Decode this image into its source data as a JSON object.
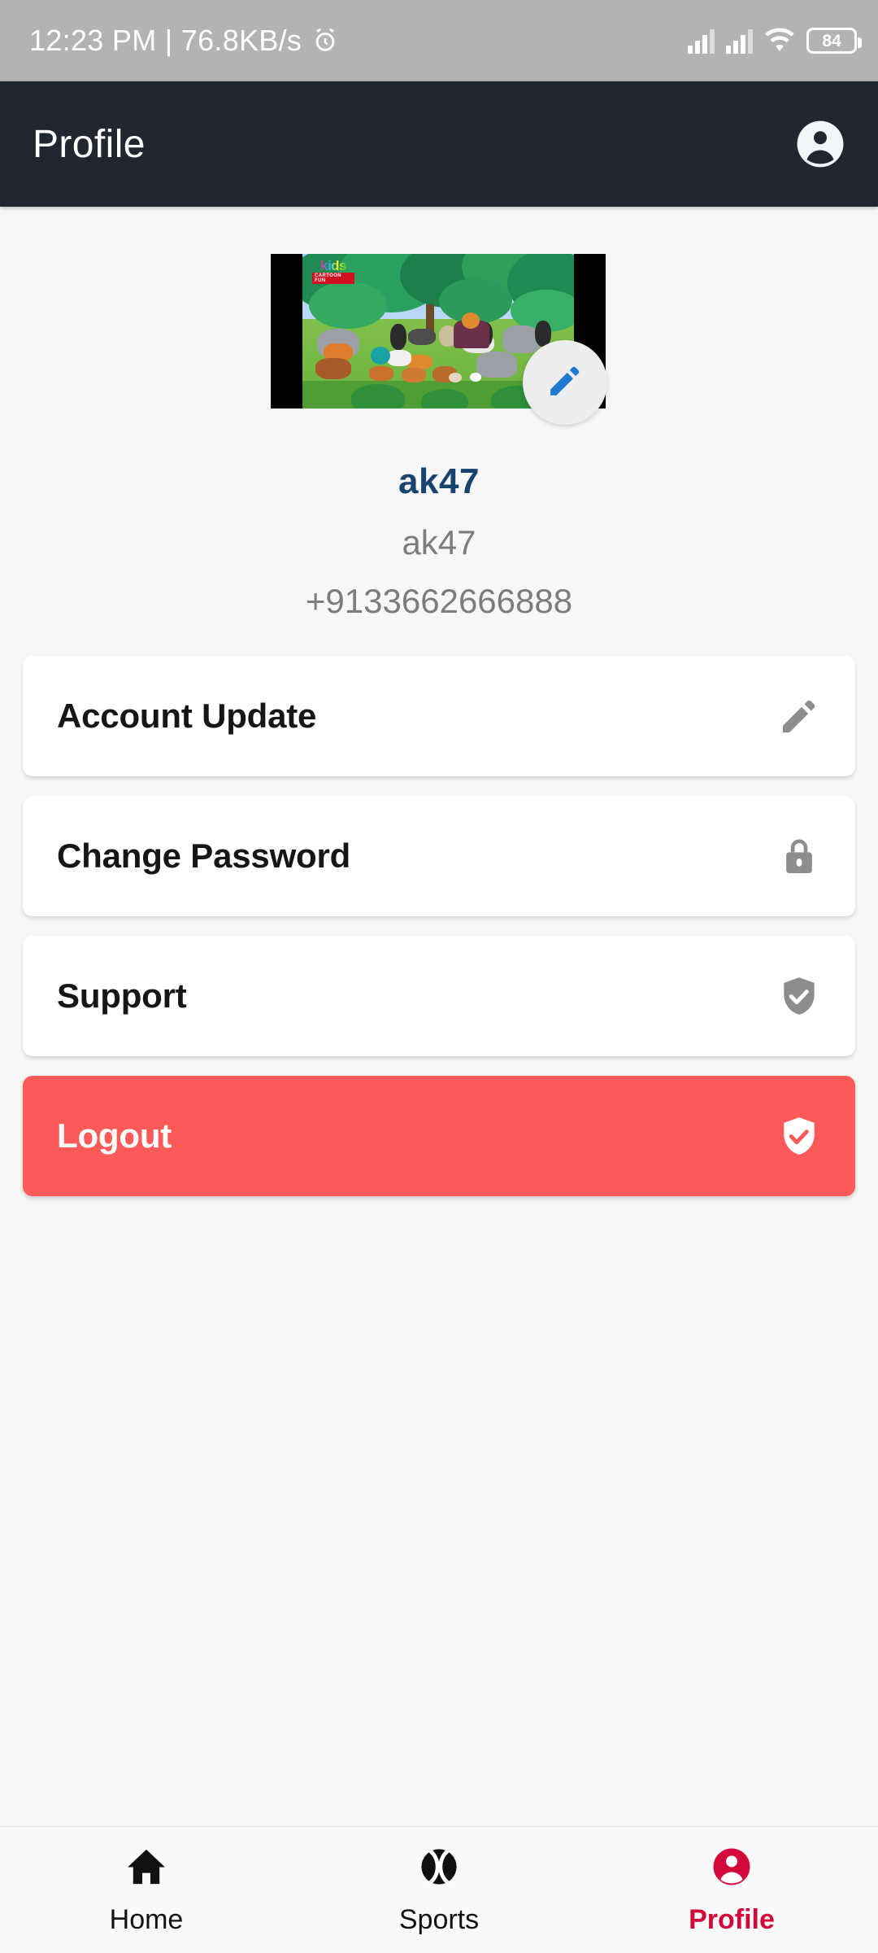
{
  "status_bar": {
    "text": "12:23 PM | 76.8KB/s",
    "alarm_icon": "alarm-clock-icon",
    "signal_icon": "cellular-signal-icon",
    "signal_icon_2": "cellular-signal-icon-2",
    "wifi_icon": "wifi-icon",
    "battery_level": "84"
  },
  "appbar": {
    "title": "Profile",
    "account_icon": "account-circle-icon"
  },
  "profile": {
    "image_alt": "kids-cartoon-jungle-animals-thumbnail",
    "image_watermark_primary": "kids",
    "image_watermark_secondary": "CARTOON FUN",
    "edit_icon": "pencil-edit-icon",
    "name": "ak47",
    "username": "ak47",
    "phone": "+9133662666888"
  },
  "menu": {
    "items": [
      {
        "label": "Account Update",
        "icon": "pencil-edit-icon",
        "style": "default"
      },
      {
        "label": "Change Password",
        "icon": "lock-icon",
        "style": "default"
      },
      {
        "label": "Support",
        "icon": "shield-check-icon",
        "style": "default"
      },
      {
        "label": "Logout",
        "icon": "shield-check-icon",
        "style": "danger"
      }
    ]
  },
  "bottom_nav": {
    "items": [
      {
        "label": "Home",
        "icon": "home-icon",
        "active": false
      },
      {
        "label": "Sports",
        "icon": "sports-ball-icon",
        "active": false
      },
      {
        "label": "Profile",
        "icon": "person-circle-icon",
        "active": true
      }
    ]
  },
  "colors": {
    "appbar_bg": "#22262f",
    "status_bar_bg": "#b3b3b5",
    "page_bg": "#f7f7f8",
    "card_bg": "#ffffff",
    "logout_bg": "#fb5a58",
    "name_color": "#18436f",
    "muted_text": "#7c7c7c",
    "accent_active": "#d1093b",
    "edit_blue": "#1e7ad0",
    "icon_gray": "#8d8d8d"
  }
}
